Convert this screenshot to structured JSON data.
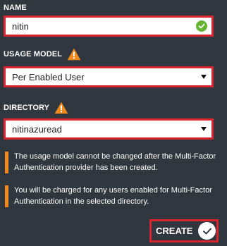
{
  "name_section": {
    "label": "NAME",
    "value": "nitin"
  },
  "usage_model_section": {
    "label": "USAGE MODEL",
    "selected": "Per Enabled User"
  },
  "directory_section": {
    "label": "DIRECTORY",
    "selected": "nitinazuread"
  },
  "notes": [
    "The usage model cannot be changed after the Multi-Factor Authentication provider has been created.",
    "You will be charged for any users enabled for Multi-Factor Authentication in the selected directory."
  ],
  "create_button": {
    "label": "CREATE"
  },
  "colors": {
    "background": "#30373f",
    "highlight_border": "#d9232d",
    "warning": "#f08a1c",
    "valid": "#67b432"
  },
  "icons": {
    "name_valid": "check-circle-icon",
    "usage_model_warning": "warning-triangle-icon",
    "directory_warning": "warning-triangle-icon",
    "dropdown": "chevron-down-icon",
    "create": "checkmark-icon"
  }
}
